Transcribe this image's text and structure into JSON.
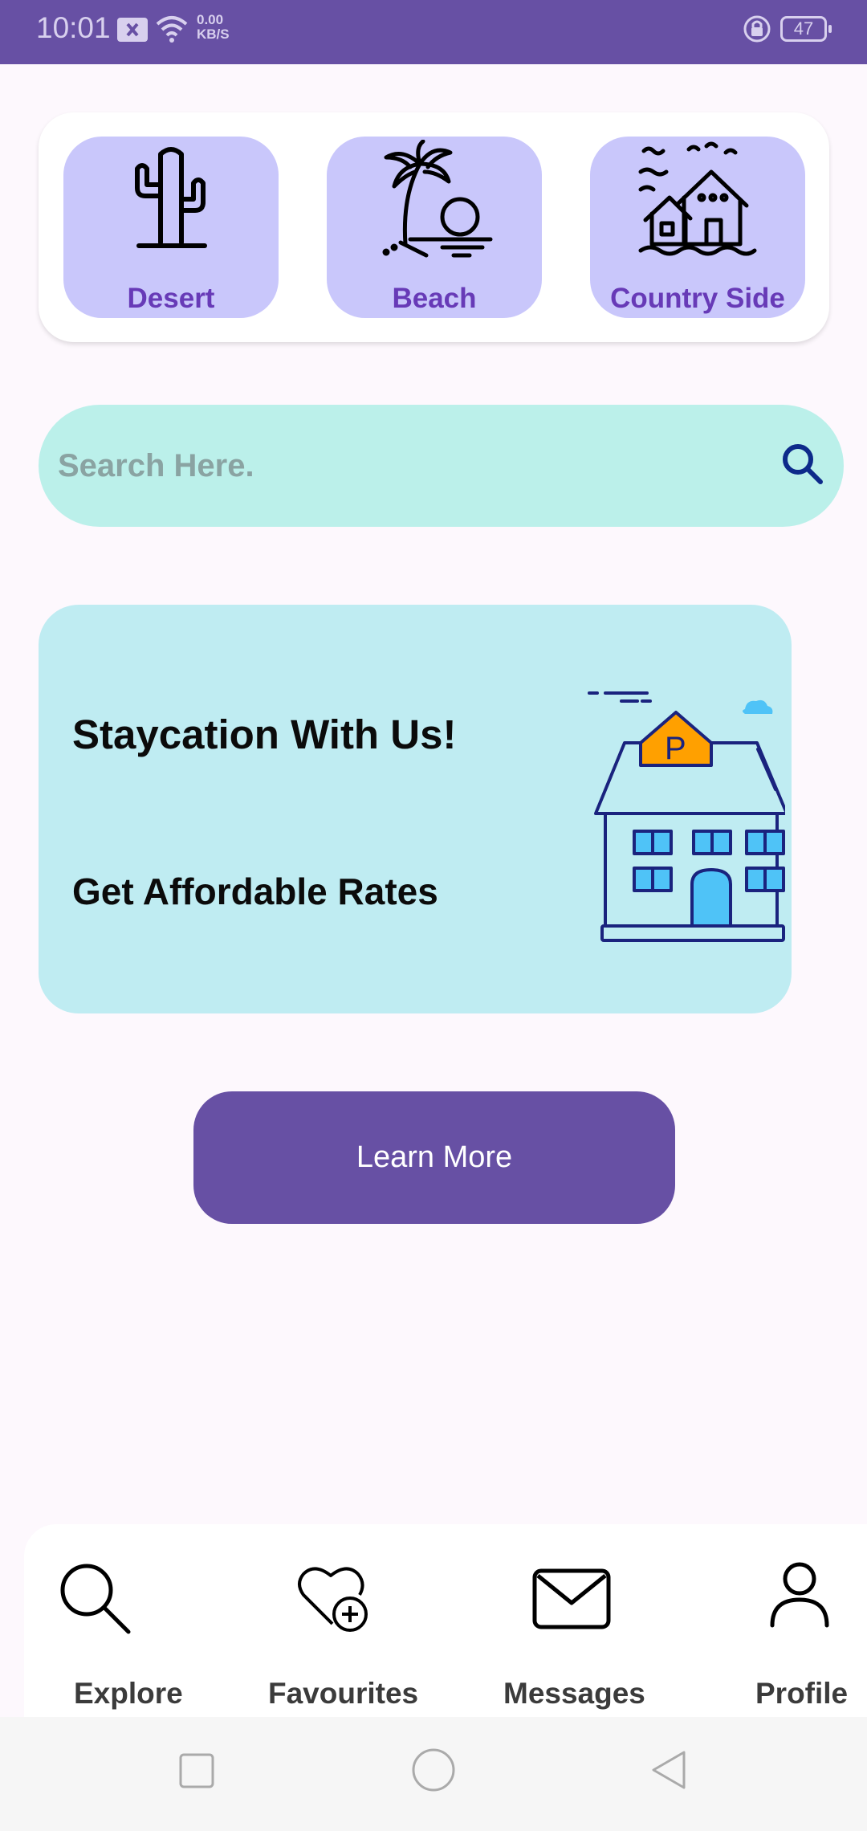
{
  "status_bar": {
    "time": "10:01",
    "network_speed_value": "0.00",
    "network_speed_unit": "KB/S",
    "battery": "47"
  },
  "categories": [
    {
      "label": "Desert",
      "icon": "cactus-icon"
    },
    {
      "label": "Beach",
      "icon": "palm-tree-sunset-icon"
    },
    {
      "label": "Country Side",
      "icon": "village-houses-icon"
    }
  ],
  "search": {
    "placeholder": "Search Here.",
    "value": ""
  },
  "promo": {
    "title": "Staycation With Us!",
    "subtitle": "Get Affordable Rates",
    "illustration": "house-with-parking-sign",
    "illustration_badge": "P"
  },
  "learn_more_label": "Learn More",
  "bottom_nav": [
    {
      "label": "Explore",
      "icon": "search-icon"
    },
    {
      "label": "Favourites",
      "icon": "heart-plus-icon"
    },
    {
      "label": "Messages",
      "icon": "envelope-icon"
    },
    {
      "label": "Profile",
      "icon": "person-icon"
    }
  ],
  "colors": {
    "primary": "#6750a4",
    "category_bg": "#c9c7fb",
    "category_text": "#673ab7",
    "search_bg": "#bbf0ea",
    "promo_bg": "#bfecf2",
    "page_bg": "#fdf8fd"
  }
}
